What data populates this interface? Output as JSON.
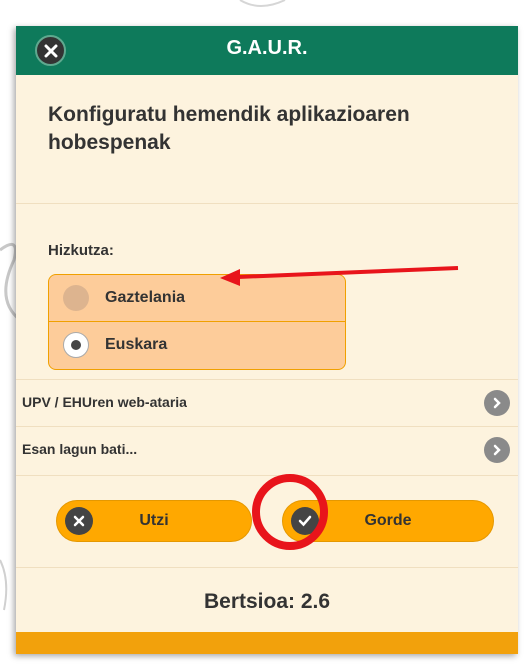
{
  "dialog": {
    "title": "G.A.U.R.",
    "intro": "Konfiguratu hemendik aplikazioaren hobespenak",
    "language": {
      "label": "Hizkutza:",
      "options": [
        {
          "label": "Gaztelania",
          "selected": false
        },
        {
          "label": "Euskara",
          "selected": true
        }
      ]
    },
    "links": [
      {
        "label": "UPV / EHUren web-ataria",
        "icon": "chevron-right-icon"
      },
      {
        "label": "Esan lagun bati...",
        "icon": "chevron-right-icon"
      }
    ],
    "buttons": {
      "cancel_label": "Utzi",
      "save_label": "Gorde"
    },
    "version": "Bertsioa: 2.6"
  },
  "colors": {
    "titlebar": "#0e7a5b",
    "background": "#fdf3de",
    "radio_group": "#fdcc9a",
    "button": "#ffa800",
    "annotation": "#e8141b",
    "bottom_bar": "#f2a10c"
  },
  "annotations": {
    "arrow_target": "Gaztelania",
    "circle_target": "save-button-icon"
  }
}
